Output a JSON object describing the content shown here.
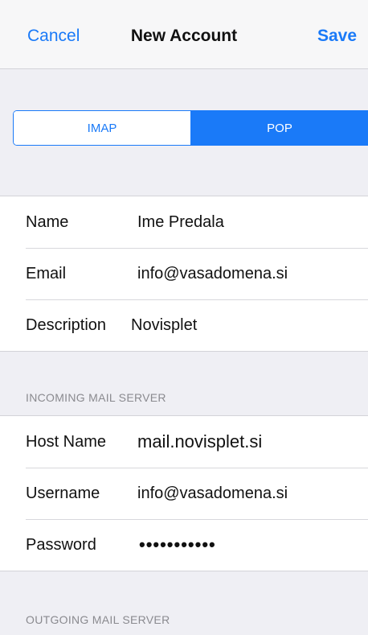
{
  "navbar": {
    "cancel_label": "Cancel",
    "title": "New Account",
    "save_label": "Save"
  },
  "account_type": {
    "options": [
      "IMAP",
      "POP"
    ],
    "selected": "POP"
  },
  "account_info": {
    "name_label": "Name",
    "name_value": "Ime Predala",
    "email_label": "Email",
    "email_value": "info@vasadomena.si",
    "description_label": "Description",
    "description_value": "Novisplet"
  },
  "incoming": {
    "header": "INCOMING MAIL SERVER",
    "host_label": "Host Name",
    "host_value": "mail.novisplet.si",
    "username_label": "Username",
    "username_value": "info@vasadomena.si",
    "password_label": "Password",
    "password_value": "•••••••••••"
  },
  "outgoing": {
    "header": "OUTGOING MAIL SERVER"
  },
  "colors": {
    "accent": "#1a7af8",
    "background": "#efeff4",
    "cell": "#ffffff",
    "section_header": "#8a8a8f"
  }
}
